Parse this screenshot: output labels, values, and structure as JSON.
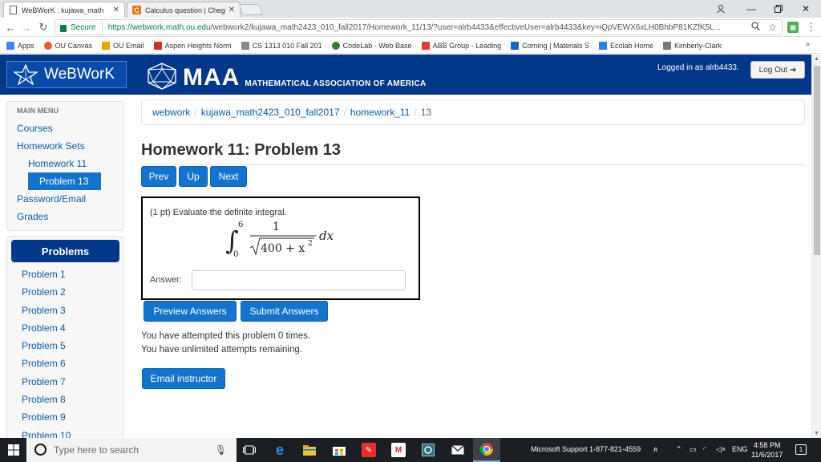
{
  "browser": {
    "tabs": [
      {
        "title": "WeBWorK : kujawa_math",
        "active": true
      },
      {
        "title": "Calculus question | Cheg",
        "active": false
      }
    ],
    "address": {
      "secure_label": "Secure",
      "url_host": "https://webwork.math.ou.edu",
      "url_path": "/webwork2/kujawa_math2423_010_fall2017/Homework_11/13/?user=alrb4433&effectiveUser=alrb4433&key=iQpVEWX6xLH0BhbP81KZfK5L..."
    },
    "bookmarks": [
      "Apps",
      "OU Canvas",
      "OU Email",
      "Aspen Heights Norm",
      "CS 1313 010 Fall 201",
      "CodeLab - Web Base",
      "ABB Group - Leading",
      "Corning | Materials S",
      "Ecolab Home",
      "Kimberly-Clark"
    ],
    "bookmark_colors": [
      "#4285f4",
      "#e85d2c",
      "#e8a400",
      "#d32f2f",
      "#888888",
      "#2e7d32",
      "#e53935",
      "#1565c0",
      "#1e88e5",
      "#777777"
    ],
    "more_bookmarks": "»"
  },
  "header": {
    "logo_text": "WeBWorK",
    "maa_big": "MAA",
    "maa_small": "MATHEMATICAL ASSOCIATION OF AMERICA",
    "logged_in": "Logged in as alrb4433.",
    "logout_label": "Log Out"
  },
  "menu": {
    "heading": "MAIN MENU",
    "courses": "Courses",
    "homework_sets": "Homework Sets",
    "homework_11": "Homework 11",
    "problem_13": "Problem 13",
    "password_email": "Password/Email",
    "grades": "Grades"
  },
  "problems_panel": {
    "button": "Problems",
    "items": [
      "Problem 1",
      "Problem 2",
      "Problem 3",
      "Problem 4",
      "Problem 5",
      "Problem 6",
      "Problem 7",
      "Problem 8",
      "Problem 9",
      "Problem 10"
    ]
  },
  "breadcrumb": {
    "items": [
      "webwork",
      "kujawa_math2423_010_fall2017",
      "homework_11"
    ],
    "current": "13"
  },
  "page": {
    "title": "Homework 11: Problem 13",
    "prev": "Prev",
    "up": "Up",
    "next": "Next",
    "statement": "(1 pt) Evaluate the definite integral.",
    "formula": {
      "lower": "0",
      "upper": "6",
      "numerator": "1",
      "radicand": "400 + x",
      "exponent": "2",
      "dx": "dx"
    },
    "answer_label": "Answer:",
    "answer_value": "",
    "preview": "Preview Answers",
    "submit": "Submit Answers",
    "attempted": "You have attempted this problem 0 times.",
    "remaining": "You have unlimited attempts remaining.",
    "email": "Email instructor"
  },
  "taskbar": {
    "search_placeholder": "Type here to search",
    "support": "Microsoft Support 1-877-821-4559",
    "lang": "ENG",
    "time": "4:58 PM",
    "date": "11/6/2017"
  }
}
